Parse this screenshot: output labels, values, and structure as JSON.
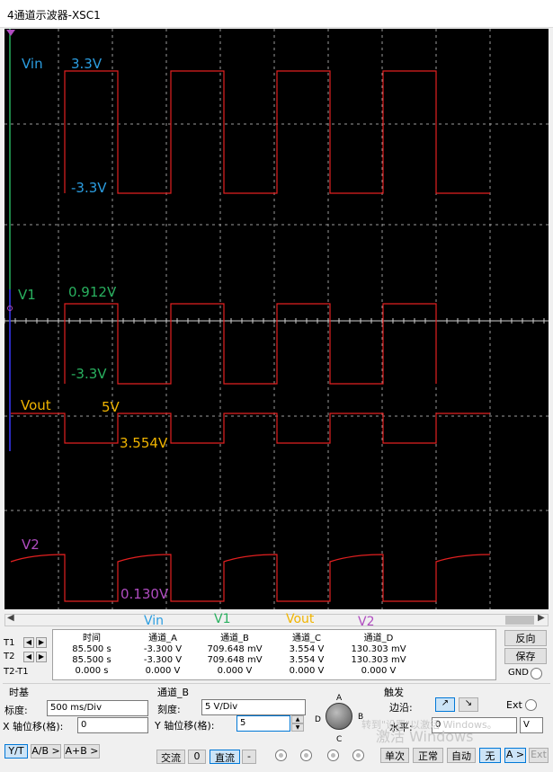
{
  "window": {
    "title": "4通道示波器-XSC1"
  },
  "screen": {
    "labels": {
      "vin": "Vin",
      "v1": "V1",
      "vout": "Vout",
      "v2": "V2",
      "vin_high": "3.3V",
      "vin_low": "-3.3V",
      "v1_high": "0.912V",
      "v1_low": "-3.3V",
      "vout_high": "5V",
      "vout_low": "3.554V",
      "v2_low": "0.130V"
    },
    "colors": {
      "trace": "#e32020",
      "grid": "#9a9a9a",
      "vin": "#2b9de0",
      "v1": "#29b05f",
      "vout": "#f0b400",
      "v2": "#b04cc0"
    }
  },
  "channel_headers": {
    "a": "Vin",
    "b": "V1",
    "c": "Vout",
    "d": "V2"
  },
  "readout": {
    "columns": [
      "时间",
      "通道_A",
      "通道_B",
      "通道_C",
      "通道_D"
    ],
    "rows": [
      {
        "label": "T1",
        "values": [
          "85.500 s",
          "-3.300 V",
          "709.648 mV",
          "3.554 V",
          "130.303 mV"
        ]
      },
      {
        "label": "T2",
        "values": [
          "85.500 s",
          "-3.300 V",
          "709.648 mV",
          "3.554 V",
          "130.303 mV"
        ]
      },
      {
        "label": "T2-T1",
        "values": [
          "0.000 s",
          "0.000 V",
          "0.000 V",
          "0.000 V",
          "0.000 V"
        ]
      }
    ]
  },
  "side_buttons": {
    "reverse": "反向",
    "save": "保存",
    "gnd": "GND"
  },
  "timebase": {
    "title": "时基",
    "scale_label": "标度:",
    "scale_value": "500 ms/Div",
    "xpos_label": "X 轴位移(格):",
    "xpos_value": "0",
    "modes": [
      "Y/T",
      "A/B >",
      "A+B >"
    ]
  },
  "channel": {
    "title": "通道_B",
    "scale_label": "刻度:",
    "scale_value": "5  V/Div",
    "ypos_label": "Y 轴位移(格):",
    "ypos_value": "5",
    "coupling": [
      "交流",
      "0",
      "直流",
      "-"
    ],
    "knob": {
      "a": "A",
      "b": "B",
      "c": "C",
      "d": "D"
    }
  },
  "trigger": {
    "title": "触发",
    "edge_label": "边沿:",
    "level_label": "水平:",
    "level_value": "0",
    "level_unit": "V",
    "ext_label": "Ext",
    "modes": [
      "单次",
      "正常",
      "自动",
      "无",
      "A >",
      "Ext"
    ]
  },
  "watermark": {
    "line1": "激活 Windows",
    "line2": "转到\"设置\"以激活 Windows。"
  }
}
